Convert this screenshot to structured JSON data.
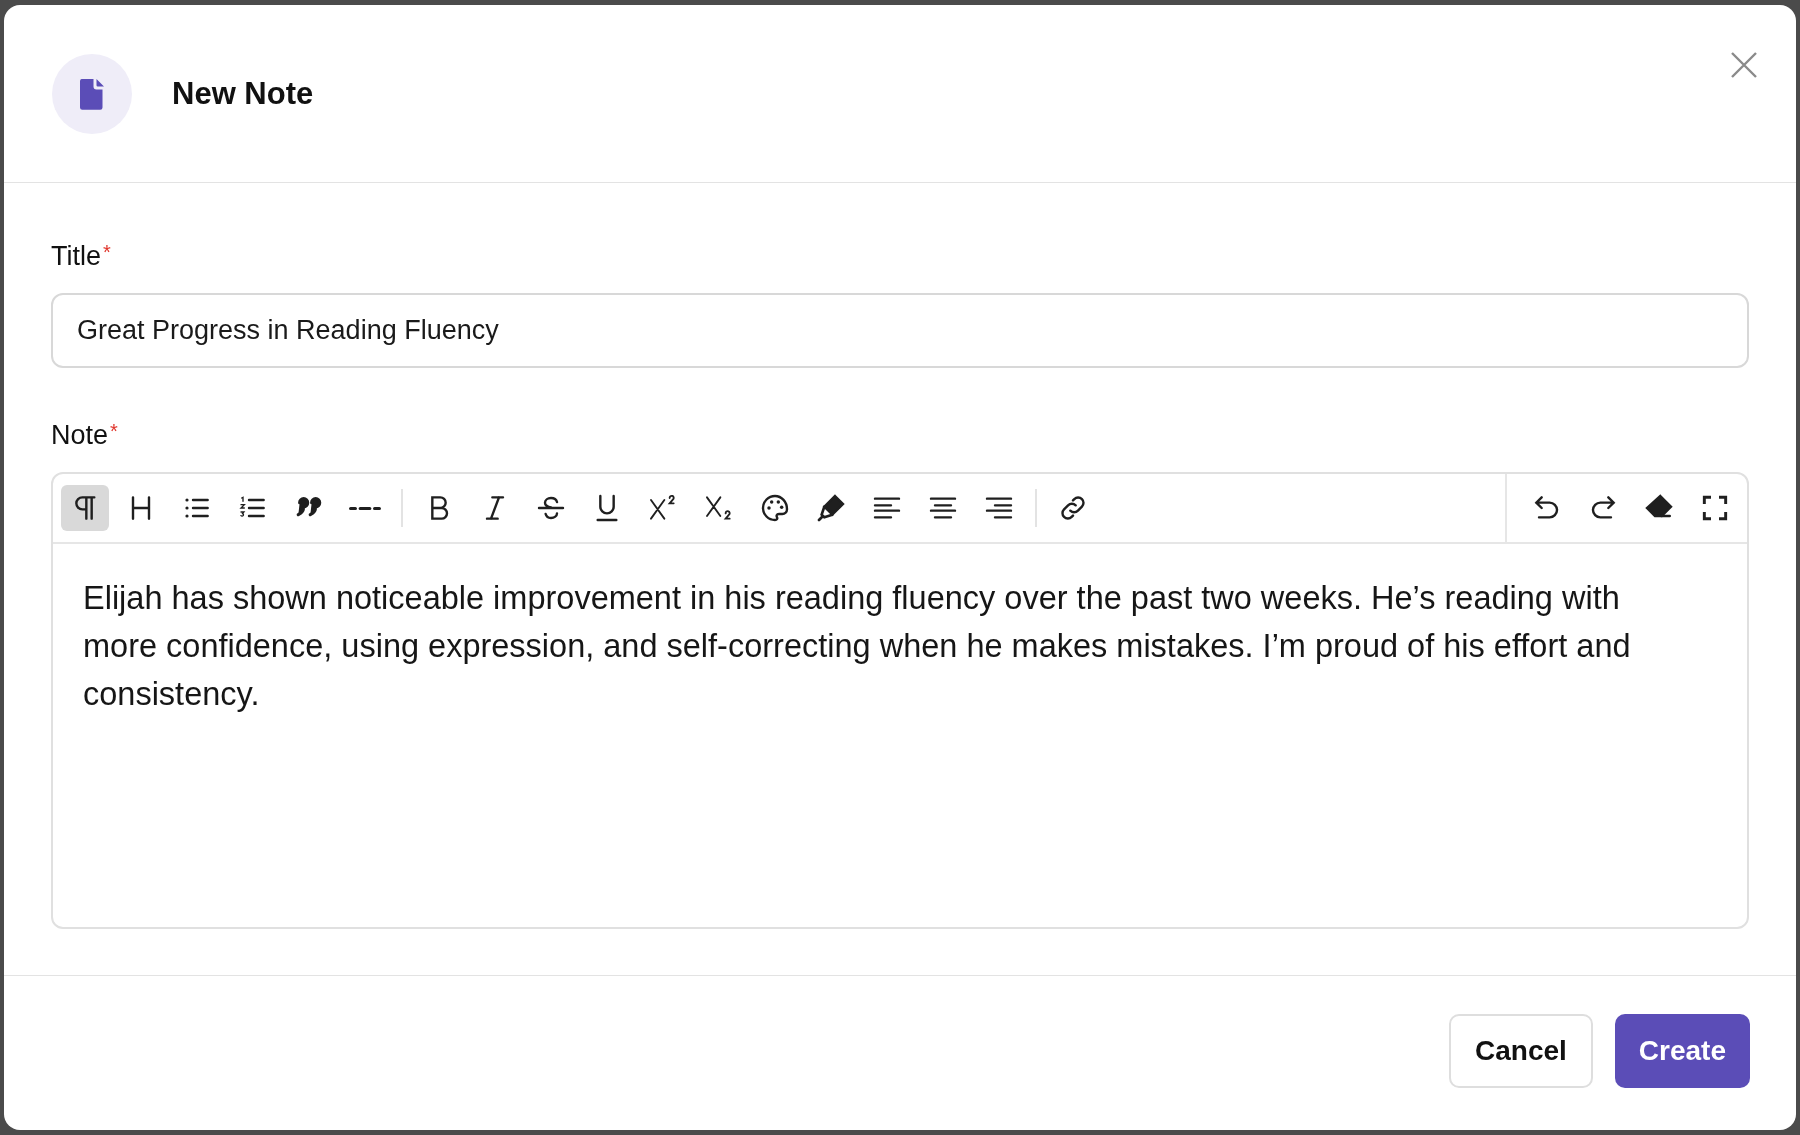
{
  "dialog": {
    "title": "New Note"
  },
  "title_field": {
    "label": "Title",
    "required_mark": "*",
    "value": "Great Progress in Reading Fluency"
  },
  "note_field": {
    "label": "Note",
    "required_mark": "*",
    "toolbar": [
      {
        "kind": "paragraph",
        "selected": true
      },
      {
        "kind": "heading",
        "selected": false
      },
      {
        "kind": "bullet-list",
        "selected": false
      },
      {
        "kind": "numbered-list",
        "selected": false
      },
      {
        "kind": "quote",
        "selected": false
      },
      {
        "kind": "rule",
        "selected": false
      },
      {
        "kind": "divider"
      },
      {
        "kind": "bold",
        "selected": false
      },
      {
        "kind": "italic",
        "selected": false
      },
      {
        "kind": "strikethrough",
        "selected": false
      },
      {
        "kind": "underline",
        "selected": false
      },
      {
        "kind": "superscript",
        "selected": false
      },
      {
        "kind": "subscript",
        "selected": false
      },
      {
        "kind": "palette",
        "selected": false
      },
      {
        "kind": "highlighter",
        "selected": false
      },
      {
        "kind": "align-left",
        "selected": false
      },
      {
        "kind": "align-center",
        "selected": false
      },
      {
        "kind": "align-right",
        "selected": false
      },
      {
        "kind": "divider"
      },
      {
        "kind": "link",
        "selected": false
      }
    ],
    "toolbar_right": [
      {
        "kind": "undo"
      },
      {
        "kind": "redo"
      },
      {
        "kind": "eraser"
      },
      {
        "kind": "fullscreen"
      }
    ],
    "value": "Elijah has shown noticeable improvement in his reading fluency over the past two weeks. He’s reading with more confidence, using expression, and self-correcting when he makes mistakes. I’m proud of his effort and consistency."
  },
  "buttons": [
    {
      "label": "Cancel",
      "kind": "secondary"
    },
    {
      "label": "Create",
      "kind": "primary"
    }
  ]
}
